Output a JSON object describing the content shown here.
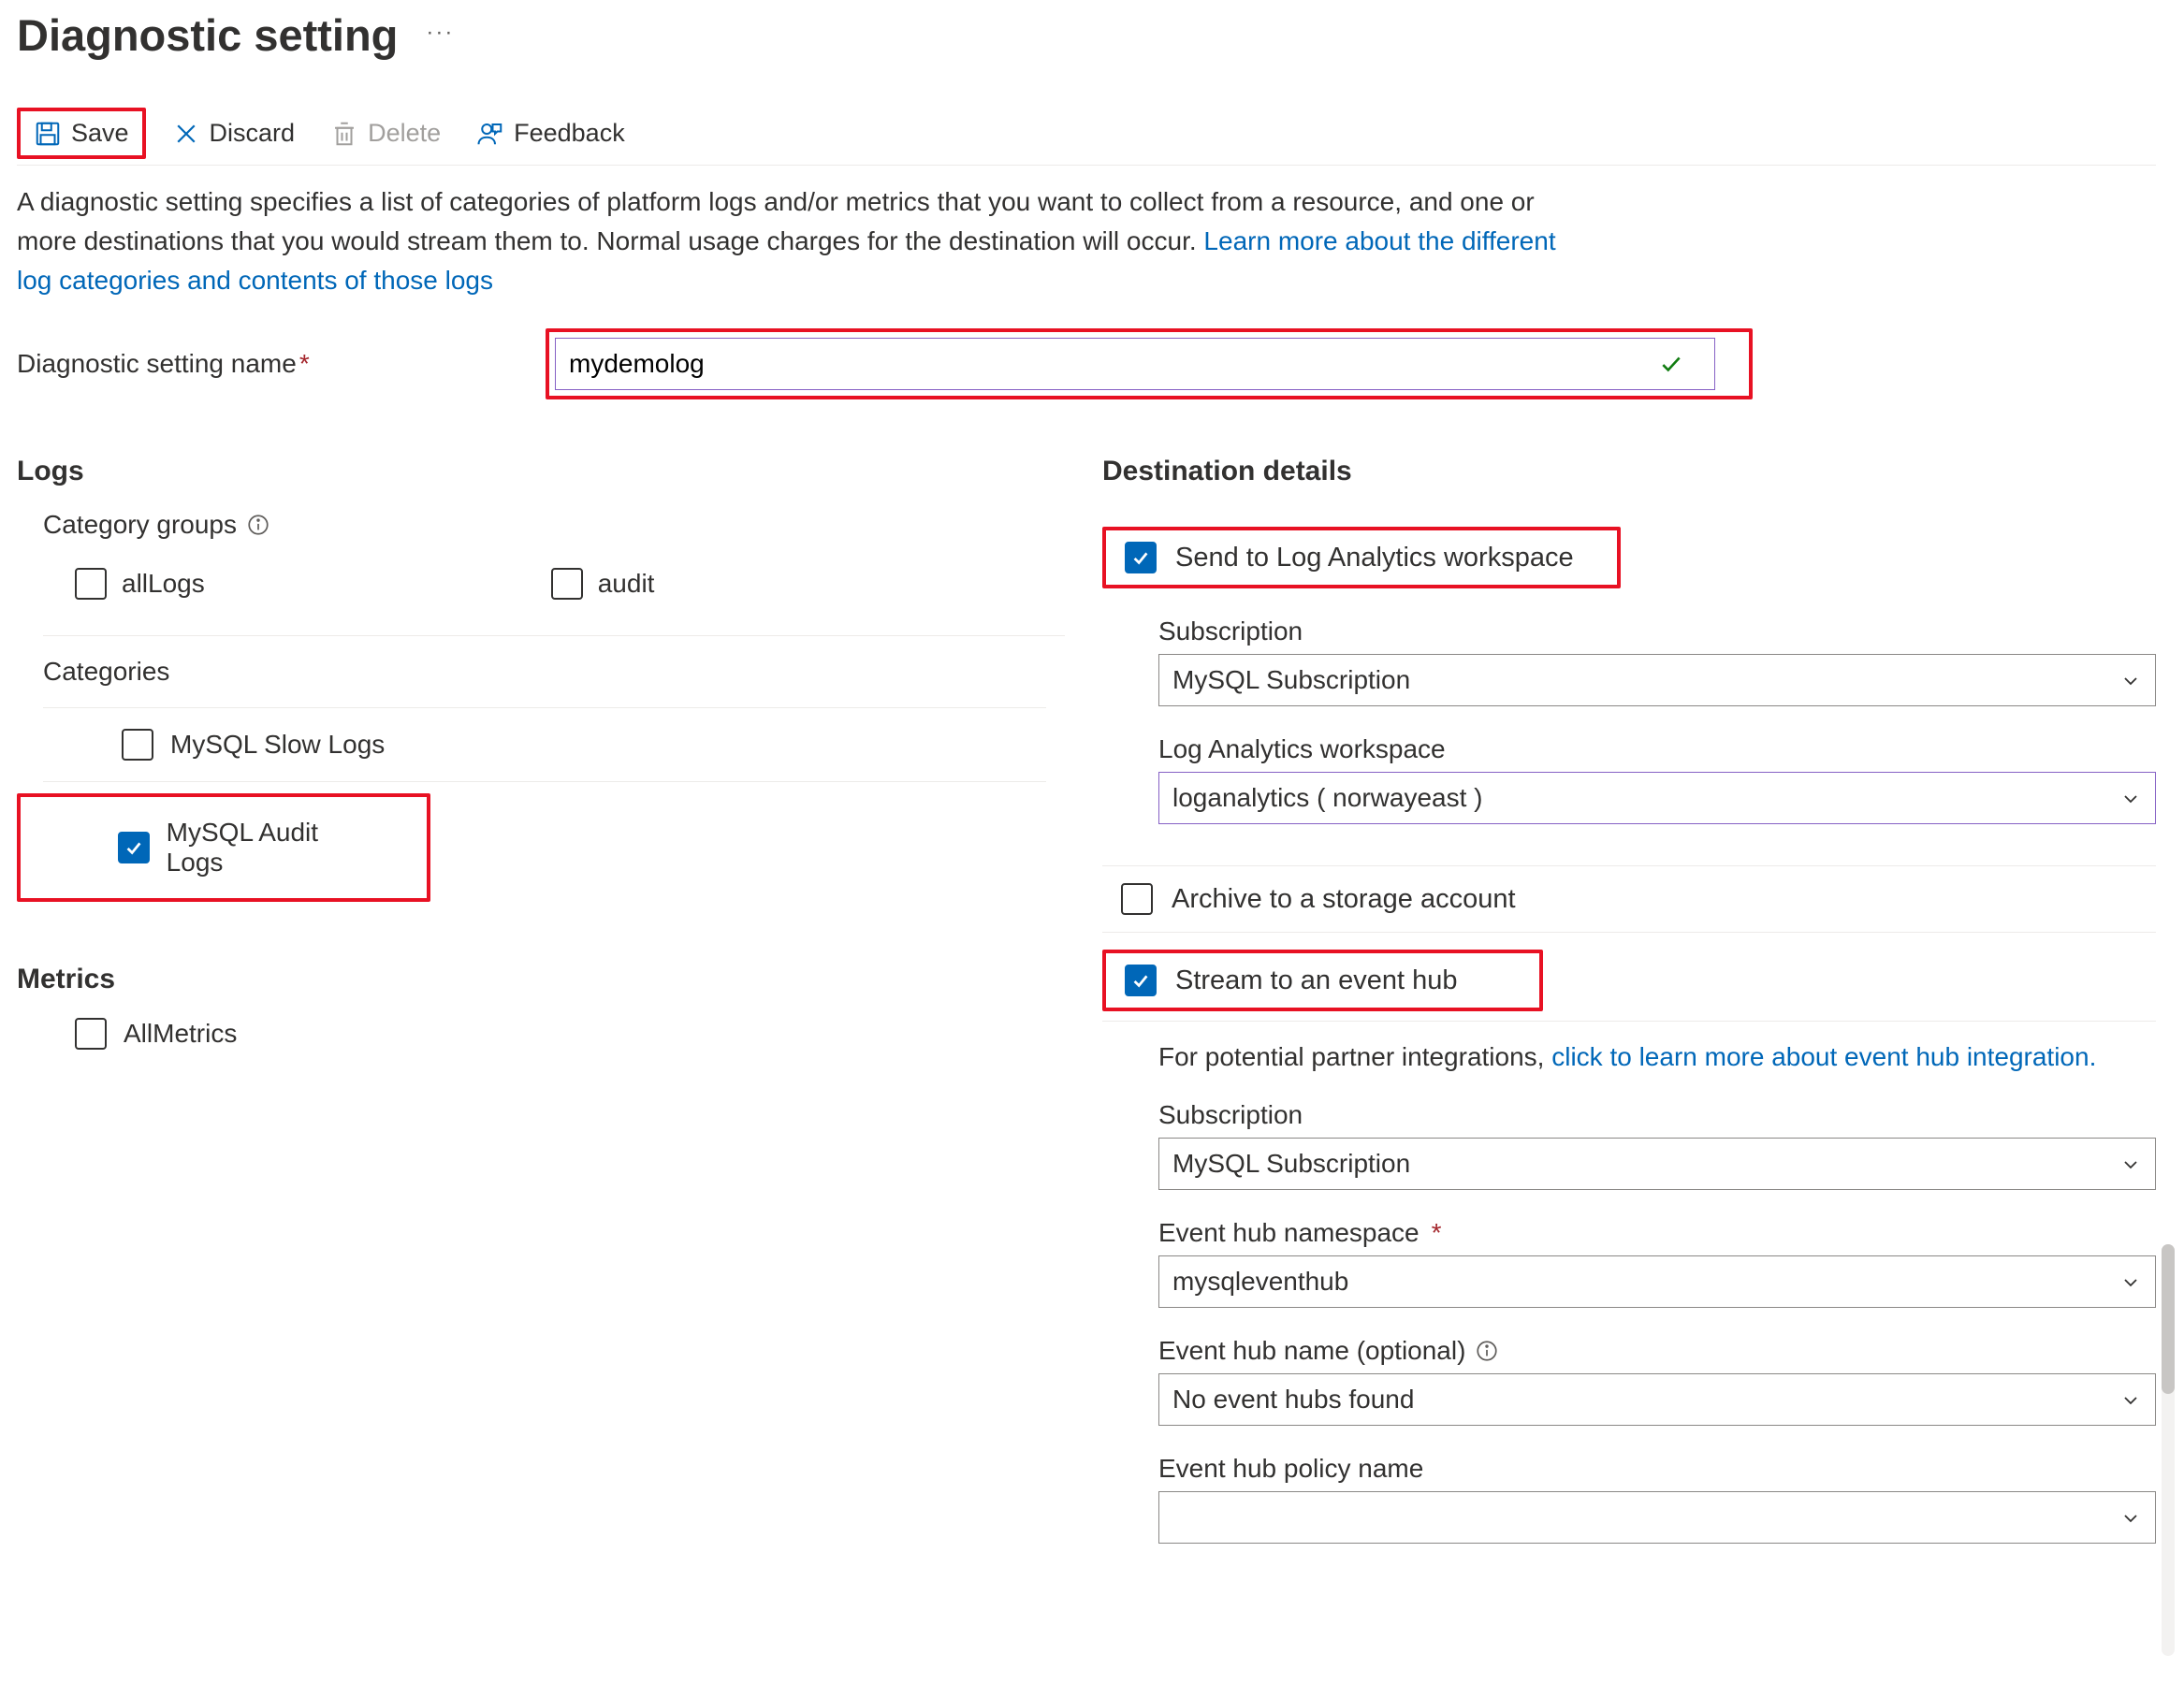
{
  "header": {
    "title": "Diagnostic setting",
    "ellipsis": "···"
  },
  "toolbar": {
    "save": "Save",
    "discard": "Discard",
    "delete": "Delete",
    "feedback": "Feedback"
  },
  "description": {
    "text": "A diagnostic setting specifies a list of categories of platform logs and/or metrics that you want to collect from a resource, and one or more destinations that you would stream them to. Normal usage charges for the destination will occur. ",
    "link": "Learn more about the different log categories and contents of those logs"
  },
  "name": {
    "label": "Diagnostic setting name",
    "value": "mydemolog"
  },
  "logs": {
    "heading": "Logs",
    "category_groups_label": "Category groups",
    "groups": {
      "allLogs": {
        "label": "allLogs",
        "checked": false
      },
      "audit": {
        "label": "audit",
        "checked": false
      }
    },
    "categories_label": "Categories",
    "categories": [
      {
        "label": "MySQL Slow Logs",
        "checked": false
      },
      {
        "label": "MySQL Audit Logs",
        "checked": true
      }
    ]
  },
  "metrics": {
    "heading": "Metrics",
    "allMetrics": {
      "label": "AllMetrics",
      "checked": false
    }
  },
  "dest": {
    "heading": "Destination details",
    "law": {
      "label": "Send to Log Analytics workspace",
      "checked": true,
      "subscription_label": "Subscription",
      "subscription_value": "MySQL Subscription",
      "workspace_label": "Log Analytics workspace",
      "workspace_value": "loganalytics ( norwayeast )"
    },
    "storage": {
      "label": "Archive to a storage account",
      "checked": false
    },
    "eh": {
      "label": "Stream to an event hub",
      "checked": true,
      "hint_prefix": "For potential partner integrations, ",
      "hint_link": "click to learn more about event hub integration.",
      "subscription_label": "Subscription",
      "subscription_value": "MySQL Subscription",
      "namespace_label": "Event hub namespace",
      "namespace_value": "mysqleventhub",
      "hubname_label": "Event hub name (optional)",
      "hubname_value": "No event hubs found",
      "policy_label": "Event hub policy name",
      "policy_value": ""
    }
  }
}
